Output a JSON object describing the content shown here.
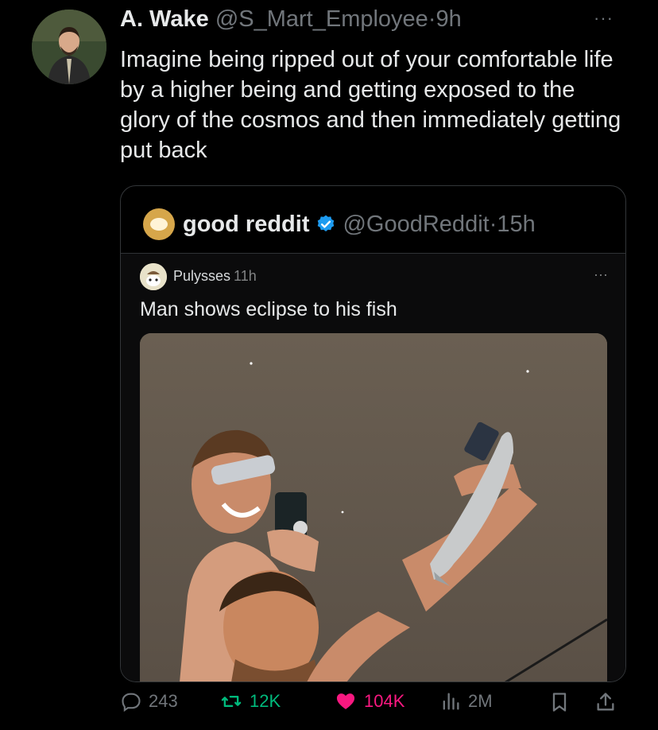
{
  "tweet": {
    "author_name": "A. Wake",
    "handle": "@S_Mart_Employee",
    "separator": "·",
    "time": "9h",
    "more": "···",
    "text": "Imagine being ripped out of your comfortable life by a higher being and getting exposed to the glory of the cosmos and then immediately getting put back"
  },
  "quote": {
    "name": "good reddit",
    "handle": "@GoodReddit",
    "separator": "·",
    "time": "15h",
    "reddit": {
      "username": "Pulysses",
      "time": "11h",
      "more": "···",
      "title": "Man shows eclipse to his fish"
    }
  },
  "actions": {
    "replies": "243",
    "reposts": "12K",
    "likes": "104K",
    "views": "2M"
  },
  "colors": {
    "background": "#000000",
    "text": "#e7e9ea",
    "muted": "#71767b",
    "repost": "#00ba7c",
    "like": "#f91880",
    "verified": "#1d9bf0"
  },
  "icons": [
    "more-icon",
    "verified-icon",
    "reply-icon",
    "repost-icon",
    "heart-icon",
    "views-icon",
    "bookmark-icon",
    "share-icon"
  ]
}
